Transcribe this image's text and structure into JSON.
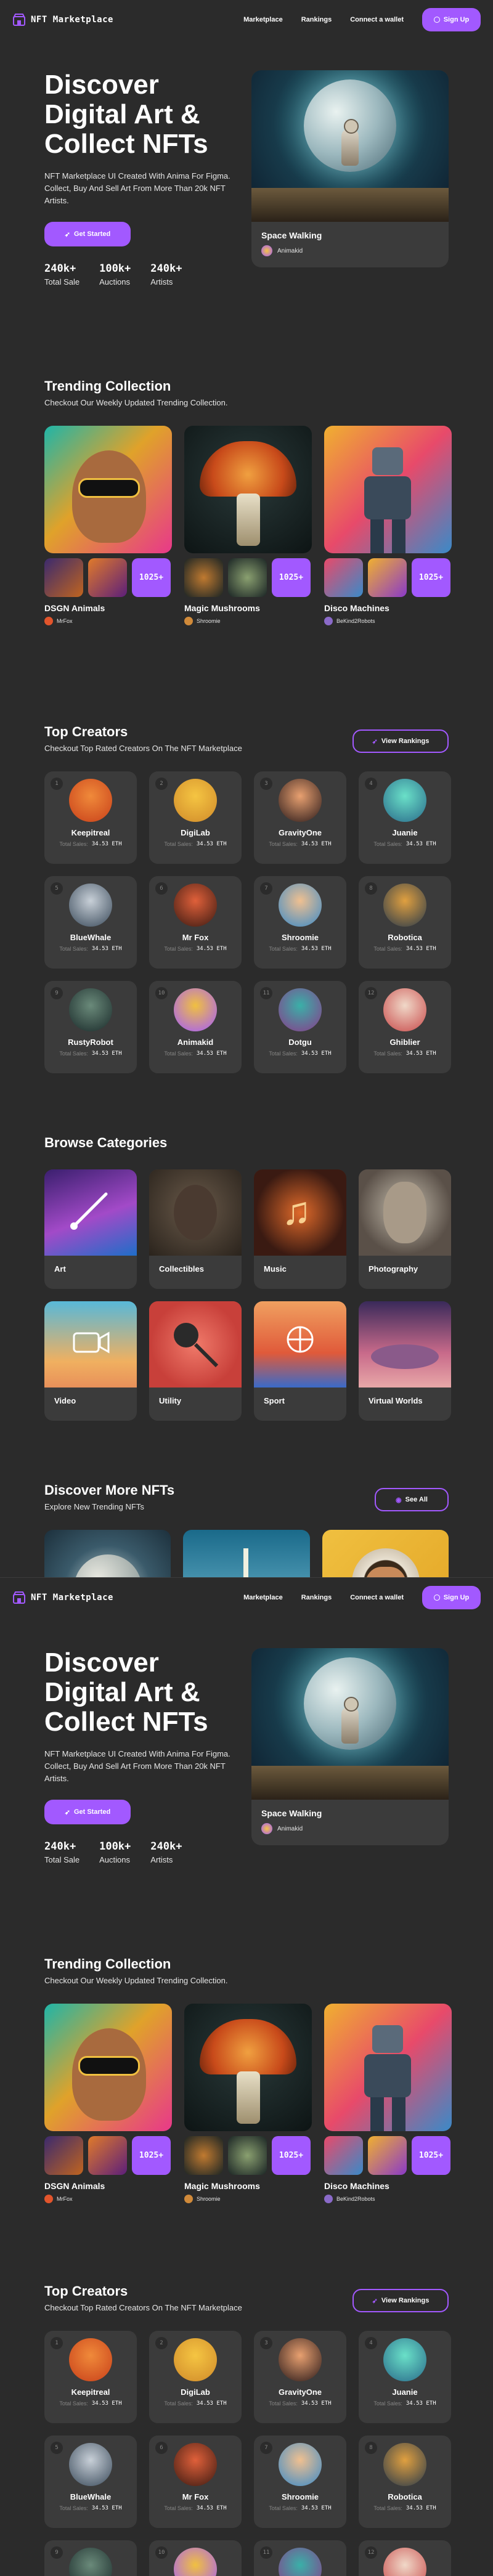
{
  "nav": {
    "brand": "NFT Marketplace",
    "links": [
      "Marketplace",
      "Rankings",
      "Connect a wallet"
    ],
    "signup": "Sign Up"
  },
  "hero": {
    "title": "Discover Digital Art & Collect NFTs",
    "subtitle": "NFT Marketplace UI Created With Anima For Figma. Collect, Buy And Sell Art From More Than 20k NFT Artists.",
    "cta": "Get Started",
    "stats": [
      {
        "value": "240k+",
        "label": "Total Sale"
      },
      {
        "value": "100k+",
        "label": "Auctions"
      },
      {
        "value": "240k+",
        "label": "Artists"
      }
    ],
    "card": {
      "name": "Space Walking",
      "artist": "Animakid"
    }
  },
  "trending": {
    "title": "Trending Collection",
    "subtitle": "Checkout Our Weekly Updated Trending Collection.",
    "items": [
      {
        "name": "DSGN Animals",
        "artist": "MrFox",
        "count": "1025+"
      },
      {
        "name": "Magic Mushrooms",
        "artist": "Shroomie",
        "count": "1025+"
      },
      {
        "name": "Disco Machines",
        "artist": "BeKind2Robots",
        "count": "1025+"
      }
    ]
  },
  "creators": {
    "title": "Top Creators",
    "subtitle": "Checkout Top Rated Creators On The NFT Marketplace",
    "button": "View Rankings",
    "sales_label": "Total Sales:",
    "items": [
      {
        "rank": "1",
        "name": "Keepitreal",
        "sales": "34.53 ETH"
      },
      {
        "rank": "2",
        "name": "DigiLab",
        "sales": "34.53 ETH"
      },
      {
        "rank": "3",
        "name": "GravityOne",
        "sales": "34.53 ETH"
      },
      {
        "rank": "4",
        "name": "Juanie",
        "sales": "34.53 ETH"
      },
      {
        "rank": "5",
        "name": "BlueWhale",
        "sales": "34.53 ETH"
      },
      {
        "rank": "6",
        "name": "Mr Fox",
        "sales": "34.53 ETH"
      },
      {
        "rank": "7",
        "name": "Shroomie",
        "sales": "34.53 ETH"
      },
      {
        "rank": "8",
        "name": "Robotica",
        "sales": "34.53 ETH"
      },
      {
        "rank": "9",
        "name": "RustyRobot",
        "sales": "34.53 ETH"
      },
      {
        "rank": "10",
        "name": "Animakid",
        "sales": "34.53 ETH"
      },
      {
        "rank": "11",
        "name": "Dotgu",
        "sales": "34.53 ETH"
      },
      {
        "rank": "12",
        "name": "Ghiblier",
        "sales": "34.53 ETH"
      }
    ]
  },
  "categories": {
    "title": "Browse Categories",
    "items": [
      "Art",
      "Collectibles",
      "Music",
      "Photography",
      "Video",
      "Utility",
      "Sport",
      "Virtual Worlds"
    ]
  },
  "discover": {
    "title": "Discover More NFTs",
    "subtitle": "Explore New Trending NFTs",
    "button": "See All"
  }
}
